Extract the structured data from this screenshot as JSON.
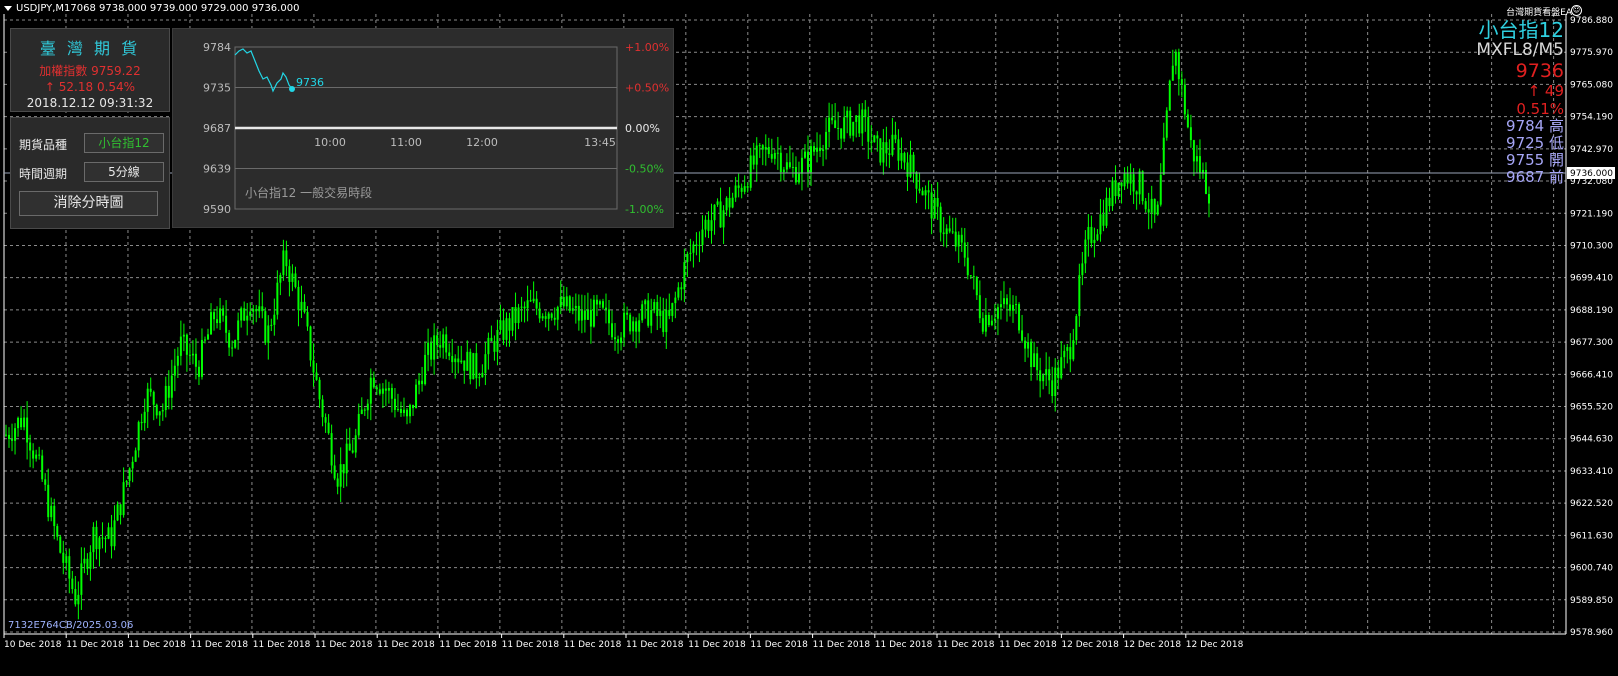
{
  "header": {
    "symbol_line": "USDJPY,M17068  9738.000 9739.000 9729.000 9736.000",
    "ea_label": "台灣期貨看盤EA",
    "ea_icon": "smiley-icon"
  },
  "info_right": {
    "instrument": "小台指12",
    "code": "MXFL8/M5",
    "price": "9736",
    "change": "↑ 49",
    "change_pct": "0.51%",
    "high": "9784 高",
    "low": "9725 低",
    "open": "9755 開",
    "prev": "9687 前"
  },
  "brand_panel": {
    "title": "臺 灣 期 貨",
    "index_line": "加權指數  9759.22",
    "change_line": "↑  52.18  0.54%",
    "datetime": "2018.12.12 09:31:32"
  },
  "controls": {
    "product_label": "期貨品種",
    "product_value": "小台指12",
    "period_label": "時間週期",
    "period_value": "5分線",
    "clear_button": "消除分時圖"
  },
  "mini_chart": {
    "y_labels": [
      "9784",
      "9735",
      "9687",
      "9639",
      "9590"
    ],
    "pct_labels": [
      "+1.00%",
      "+0.50%",
      "0.00%",
      "-0.50%",
      "-1.00%"
    ],
    "time_labels": [
      "10:00",
      "11:00",
      "12:00",
      "13:45"
    ],
    "current_label": "9736",
    "caption": "小台指12  一般交易時段",
    "colors": {
      "up": "#e03030",
      "down": "#30c030",
      "line": "#22d6e6"
    }
  },
  "axis": {
    "price_labels": [
      "9786.880",
      "9775.970",
      "9765.080",
      "9754.190",
      "9742.970",
      "9732.080",
      "9721.190",
      "9710.300",
      "9699.410",
      "9688.190",
      "9677.300",
      "9666.410",
      "9655.520",
      "9644.630",
      "9633.410",
      "9622.520",
      "9611.630",
      "9600.740",
      "9589.850",
      "9578.960"
    ],
    "current_price_tag": "9736.000",
    "date_labels": [
      "10 Dec 2018",
      "11 Dec 2018",
      "11 Dec 2018",
      "11 Dec 2018",
      "11 Dec 2018",
      "11 Dec 2018",
      "11 Dec 2018",
      "11 Dec 2018",
      "11 Dec 2018",
      "11 Dec 2018",
      "11 Dec 2018",
      "11 Dec 2018",
      "11 Dec 2018",
      "11 Dec 2018",
      "11 Dec 2018",
      "11 Dec 2018",
      "11 Dec 2018",
      "12 Dec 2018",
      "12 Dec 2018",
      "12 Dec 2018"
    ]
  },
  "watermark": "7132E764CB/2025.03.06",
  "colors": {
    "background": "#000000",
    "grid": "#8a8a8a",
    "candle": "#00ff00",
    "price_line": "#9aa4b8"
  },
  "chart_data": {
    "type": "candlestick",
    "symbol": "USDJPY,M17068",
    "ylim": [
      9578.96,
      9786.88
    ],
    "close_path": [
      [
        0,
        9646
      ],
      [
        1,
        9652
      ],
      [
        2,
        9632
      ],
      [
        3,
        9608
      ],
      [
        4,
        9590
      ],
      [
        5,
        9612
      ],
      [
        6,
        9610
      ],
      [
        7,
        9632
      ],
      [
        8,
        9660
      ],
      [
        9,
        9655
      ],
      [
        10,
        9677
      ],
      [
        11,
        9669
      ],
      [
        12,
        9688
      ],
      [
        13,
        9678
      ],
      [
        14,
        9693
      ],
      [
        15,
        9680
      ],
      [
        16,
        9707
      ],
      [
        17,
        9688
      ],
      [
        18,
        9658
      ],
      [
        19,
        9632
      ],
      [
        20,
        9643
      ],
      [
        21,
        9667
      ],
      [
        22,
        9660
      ],
      [
        23,
        9650
      ],
      [
        24,
        9671
      ],
      [
        25,
        9680
      ],
      [
        26,
        9673
      ],
      [
        27,
        9668
      ],
      [
        28,
        9678
      ],
      [
        29,
        9685
      ],
      [
        30,
        9690
      ],
      [
        31,
        9689
      ],
      [
        32,
        9690
      ],
      [
        33,
        9686
      ],
      [
        34,
        9688
      ],
      [
        35,
        9682
      ],
      [
        36,
        9686
      ],
      [
        37,
        9688
      ],
      [
        38,
        9684
      ],
      [
        39,
        9705
      ],
      [
        40,
        9718
      ],
      [
        41,
        9722
      ],
      [
        42,
        9730
      ],
      [
        43,
        9740
      ],
      [
        44,
        9745
      ],
      [
        45,
        9736
      ],
      [
        46,
        9740
      ],
      [
        47,
        9750
      ],
      [
        48,
        9752
      ],
      [
        49,
        9754
      ],
      [
        50,
        9743
      ],
      [
        51,
        9745
      ],
      [
        52,
        9737
      ],
      [
        53,
        9725
      ],
      [
        54,
        9715
      ],
      [
        55,
        9708
      ],
      [
        56,
        9686
      ],
      [
        57,
        9690
      ],
      [
        58,
        9688
      ],
      [
        59,
        9669
      ],
      [
        60,
        9664
      ],
      [
        61,
        9675
      ],
      [
        62,
        9712
      ],
      [
        63,
        9723
      ],
      [
        64,
        9736
      ],
      [
        65,
        9732
      ],
      [
        66,
        9718
      ],
      [
        67,
        9780
      ],
      [
        68,
        9744
      ],
      [
        69,
        9730
      ]
    ]
  }
}
